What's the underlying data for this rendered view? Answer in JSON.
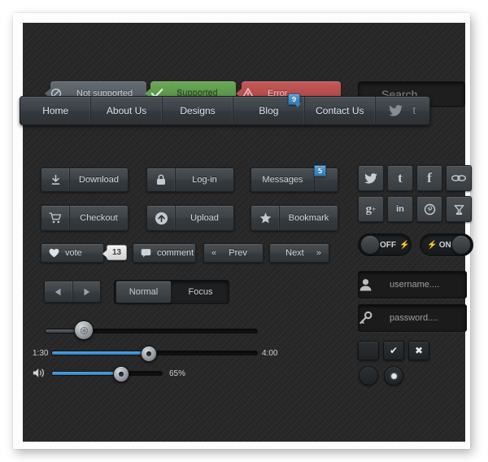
{
  "status_tags": [
    {
      "label": "Not supported",
      "icon": "ban-icon",
      "color": "#565e66"
    },
    {
      "label": "Supported",
      "icon": "check-icon",
      "color": "#5a9a4a"
    },
    {
      "label": "Error",
      "icon": "warning-icon",
      "color": "#b84a4a"
    }
  ],
  "search": {
    "placeholder": "Search...",
    "value": "",
    "icon": "search-icon"
  },
  "nav": {
    "items": [
      "Home",
      "About Us",
      "Designs",
      "Blog",
      "Contact Us"
    ],
    "badge": {
      "value": "9",
      "attached_to": "Blog"
    },
    "social": [
      "twitter-icon",
      "tumblr-icon"
    ]
  },
  "buttons": [
    {
      "label": "Download",
      "icon": "download-icon"
    },
    {
      "label": "Log-in",
      "icon": "lock-icon"
    },
    {
      "label": "Messages",
      "icon": "",
      "badge": "5"
    },
    {
      "label": "Checkout",
      "icon": "cart-icon"
    },
    {
      "label": "Upload",
      "icon": "upload-icon"
    },
    {
      "label": "Bookmark",
      "icon": "star-icon"
    }
  ],
  "small_buttons": [
    {
      "label": "vote",
      "icon": "heart-icon",
      "count": "13"
    },
    {
      "label": "comment",
      "icon": "comment-icon"
    },
    {
      "label": "Prev",
      "icon": "double-left-icon"
    },
    {
      "label": "Next",
      "icon": "double-right-icon"
    }
  ],
  "arrow_pair": {
    "prev": "left-triangle-icon",
    "next": "right-triangle-icon"
  },
  "segmented": {
    "options": [
      "Normal",
      "Focus"
    ],
    "selected": "Normal"
  },
  "sliders": {
    "plain": {
      "percent": 18
    },
    "scrub": {
      "left_label": "1:30",
      "right_label": "4:00",
      "percent": 47
    },
    "volume": {
      "label": "65%",
      "percent": 62,
      "icon": "volume-icon"
    }
  },
  "social_grid": [
    "twitter-icon",
    "tumblr-icon",
    "facebook-icon",
    "flickr-icon",
    "googleplus-icon",
    "linkedin-icon",
    "pinterest-icon",
    "vimeo-icon"
  ],
  "social_glyphs": [
    "ᴠ",
    "t",
    "f",
    "∞",
    "g",
    "in",
    "р",
    "⑂"
  ],
  "toggles": [
    {
      "label": "OFF",
      "state": "off"
    },
    {
      "label": "ON",
      "state": "on"
    }
  ],
  "login": [
    {
      "placeholder": "username....",
      "icon": "user-icon"
    },
    {
      "placeholder": "password....",
      "icon": "key-icon"
    }
  ],
  "checkboxes": [
    {
      "state": "empty",
      "glyph": ""
    },
    {
      "state": "checked",
      "glyph": "✔"
    },
    {
      "state": "cross",
      "glyph": "✖"
    }
  ],
  "radios": [
    {
      "state": "empty"
    },
    {
      "state": "selected"
    }
  ]
}
